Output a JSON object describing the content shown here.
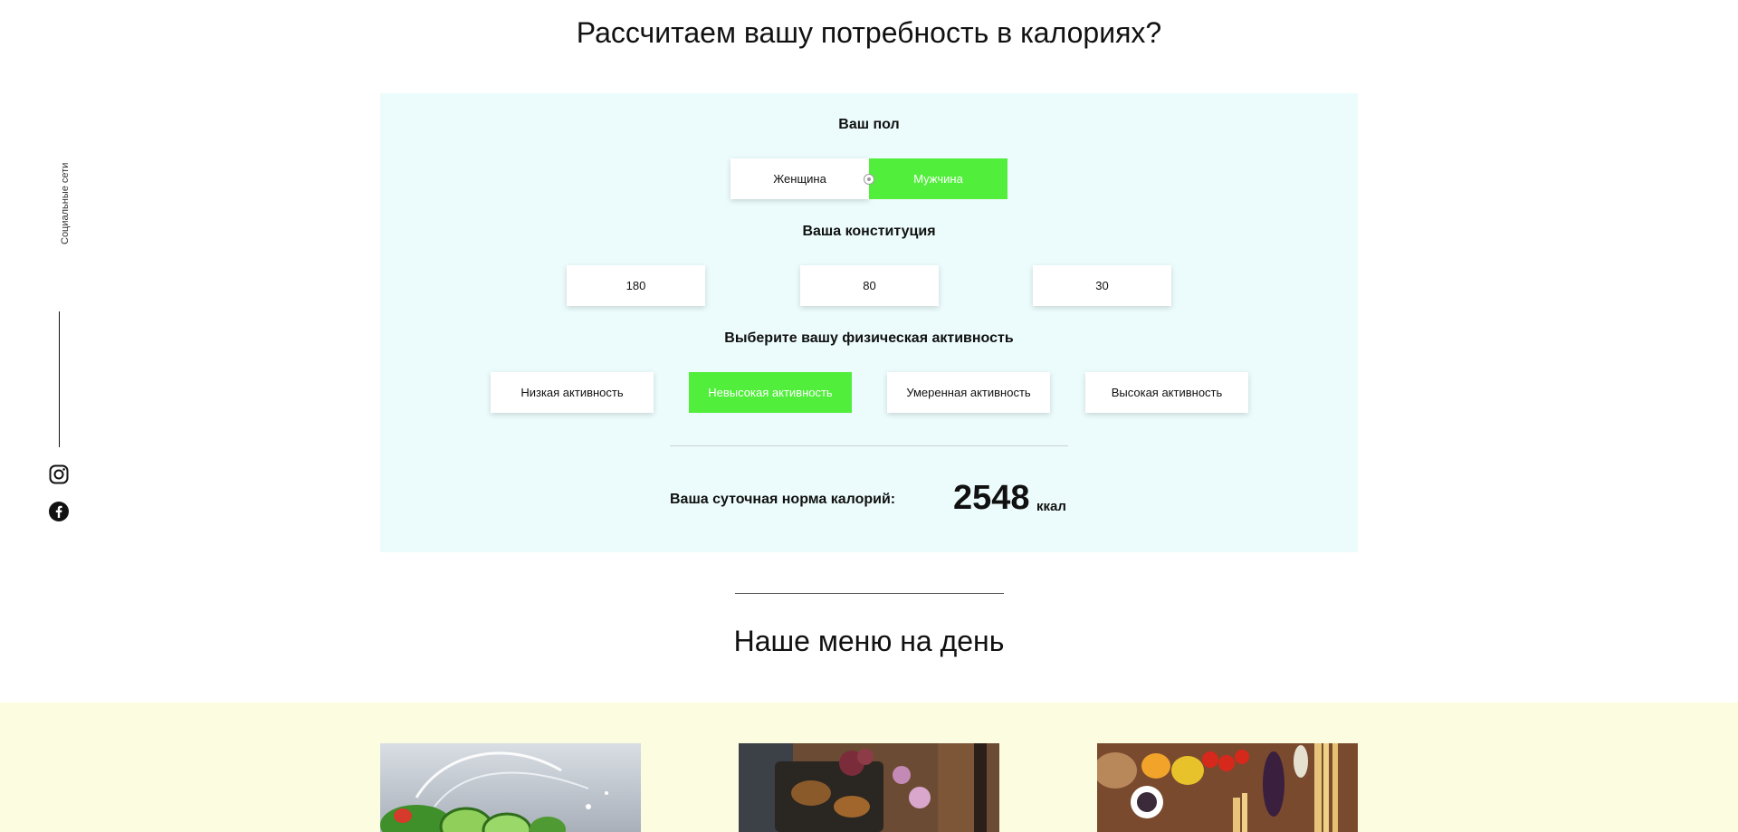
{
  "page": {
    "title": "Рассчитаем вашу потребность в калориях?"
  },
  "calculator": {
    "gender_label": "Ваш пол",
    "gender_options": [
      "Женщина",
      "Мужчина"
    ],
    "gender_selected": "Мужчина",
    "constitution_label": "Ваша конституция",
    "constitution_values": [
      "180",
      "80",
      "30"
    ],
    "activity_label": "Выберите вашу физическая активность",
    "activity_options": [
      "Низкая активность",
      "Невысокая активность",
      "Умеренная активность",
      "Высокая активность"
    ],
    "activity_selected": "Невысокая активность",
    "result_label": "Ваша суточная норма калорий:",
    "result_value": "2548",
    "result_unit": "ккал"
  },
  "menu": {
    "title": "Наше меню на день"
  },
  "social": {
    "label": "Социальные сети",
    "icons": [
      "instagram-icon",
      "facebook-icon"
    ]
  },
  "colors": {
    "accent_green": "#52ee3c",
    "panel_bg": "#ecfcfc",
    "menu_band_bg": "#fcfde0"
  }
}
